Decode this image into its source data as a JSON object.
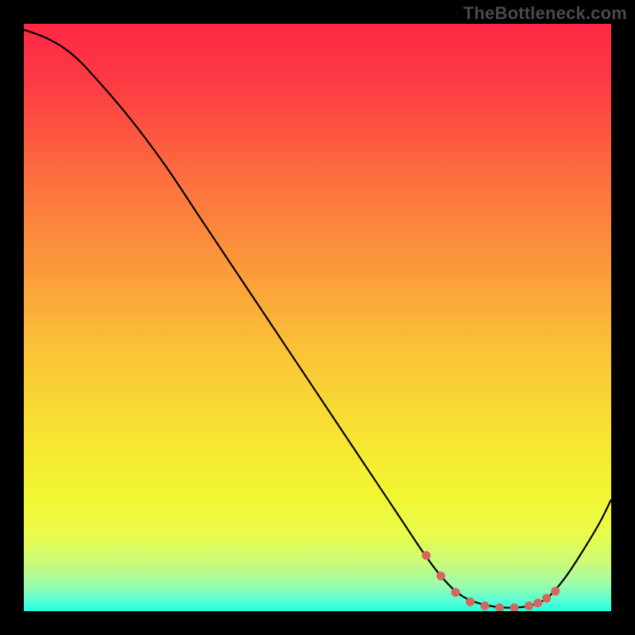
{
  "watermark": "TheBottleneck.com",
  "colors": {
    "gradient_stops": [
      {
        "offset": 0.0,
        "hex": "#fd2846"
      },
      {
        "offset": 0.1,
        "hex": "#fd3a43"
      },
      {
        "offset": 0.25,
        "hex": "#fc6b3f"
      },
      {
        "offset": 0.4,
        "hex": "#fb953b"
      },
      {
        "offset": 0.55,
        "hex": "#fac137"
      },
      {
        "offset": 0.7,
        "hex": "#f7e433"
      },
      {
        "offset": 0.8,
        "hex": "#f2f631"
      },
      {
        "offset": 0.87,
        "hex": "#e9fb4b"
      },
      {
        "offset": 0.92,
        "hex": "#c9fb7c"
      },
      {
        "offset": 0.955,
        "hex": "#9cfcab"
      },
      {
        "offset": 0.985,
        "hex": "#4ffed6"
      },
      {
        "offset": 1.0,
        "hex": "#22ffe2"
      }
    ],
    "curve": "#000000",
    "dot": "#d9645e",
    "frame": "#000000"
  },
  "chart_data": {
    "type": "line",
    "title": "",
    "xlabel": "",
    "ylabel": "",
    "xlim": [
      0,
      100
    ],
    "ylim": [
      0,
      100
    ],
    "series": [
      {
        "name": "bottleneck-curve",
        "x": [
          0,
          4,
          8,
          12,
          18,
          24,
          30,
          38,
          46,
          54,
          60,
          64,
          68,
          71,
          74,
          77,
          80,
          83,
          86,
          89,
          92,
          95,
          98,
          100
        ],
        "y": [
          99,
          97.5,
          95,
          91,
          84,
          76,
          67,
          55,
          43,
          31,
          22,
          16,
          10,
          6,
          3,
          1.5,
          0.8,
          0.6,
          0.9,
          2.2,
          5.5,
          10,
          15,
          19
        ]
      }
    ],
    "dots": {
      "name": "highlight-range",
      "x": [
        68.5,
        71,
        73.5,
        76,
        78.5,
        81,
        83.5,
        86,
        87.5,
        89,
        90.5
      ],
      "y": [
        9.5,
        6.0,
        3.2,
        1.6,
        0.9,
        0.6,
        0.6,
        0.9,
        1.4,
        2.2,
        3.4
      ]
    }
  }
}
